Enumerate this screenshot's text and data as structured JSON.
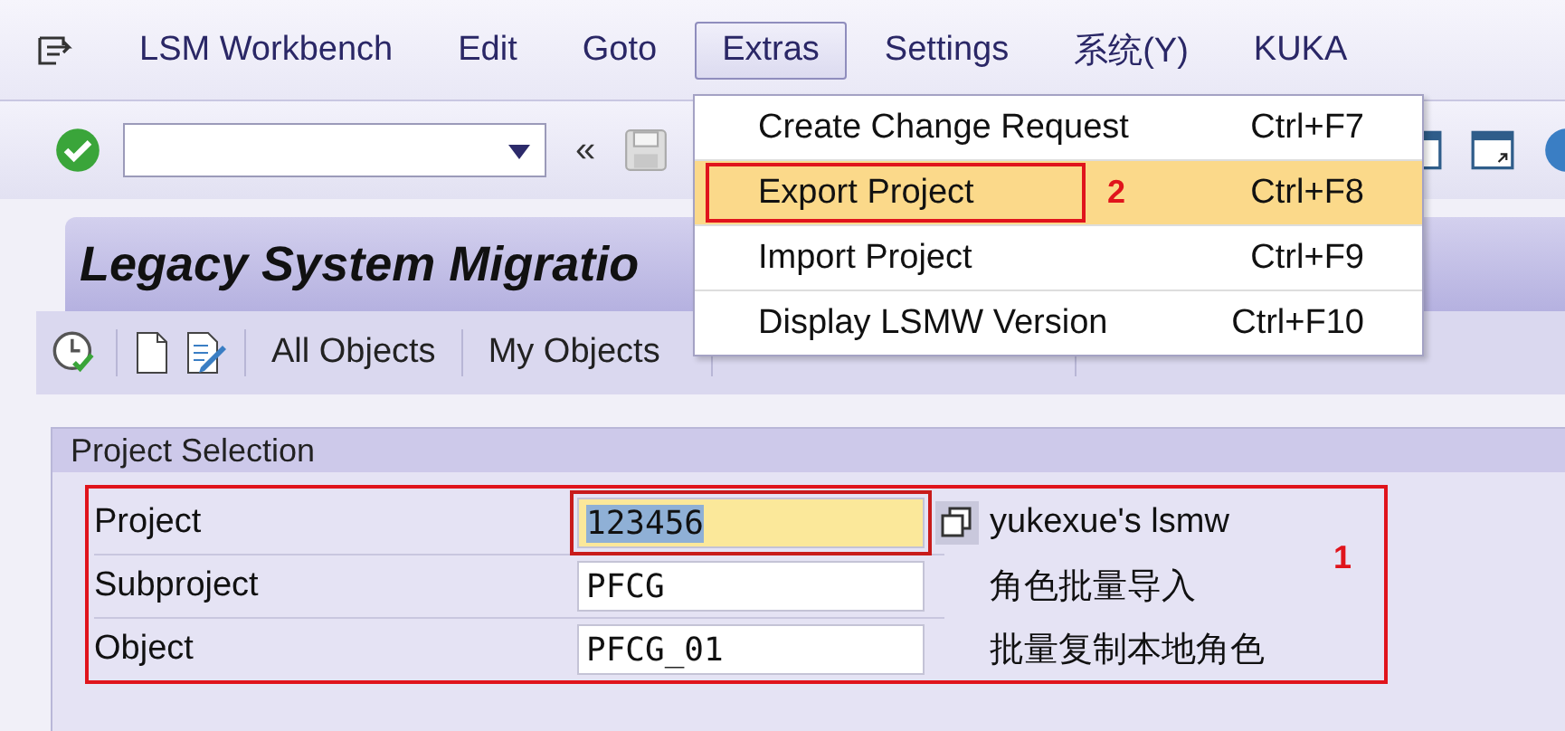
{
  "menu_bar": {
    "items": [
      {
        "label": "LSM Workbench",
        "selected": false
      },
      {
        "label": "Edit",
        "selected": false
      },
      {
        "label": "Goto",
        "selected": false
      },
      {
        "label": "Extras",
        "selected": true
      },
      {
        "label": "Settings",
        "selected": false
      },
      {
        "label": "系统(Y)",
        "selected": false
      },
      {
        "label": "KUKA",
        "selected": false
      }
    ]
  },
  "dropdown_menu": {
    "items": [
      {
        "label": "Create Change Request",
        "shortcut": "Ctrl+F7",
        "selected": false
      },
      {
        "label": "Export Project",
        "shortcut": "Ctrl+F8",
        "selected": true,
        "annotation": "2"
      },
      {
        "label": "Import Project",
        "shortcut": "Ctrl+F9",
        "selected": false
      },
      {
        "label": "Display LSMW Version",
        "shortcut": "Ctrl+F10",
        "selected": false
      }
    ]
  },
  "screen_title": "Legacy System Migratio",
  "toolbar": {
    "collapse_label": "«"
  },
  "app_toolbar": {
    "buttons": [
      "All Objects",
      "My Objects"
    ]
  },
  "project_selection": {
    "title": "Project Selection",
    "annotation": "1",
    "fields": [
      {
        "label": "Project",
        "value": "123456",
        "description": "yukexue's lsmw",
        "focused": true
      },
      {
        "label": "Subproject",
        "value": "PFCG",
        "description": "角色批量导入",
        "focused": false
      },
      {
        "label": "Object",
        "value": "PFCG_01",
        "description": "批量复制本地角色",
        "focused": false
      }
    ]
  }
}
